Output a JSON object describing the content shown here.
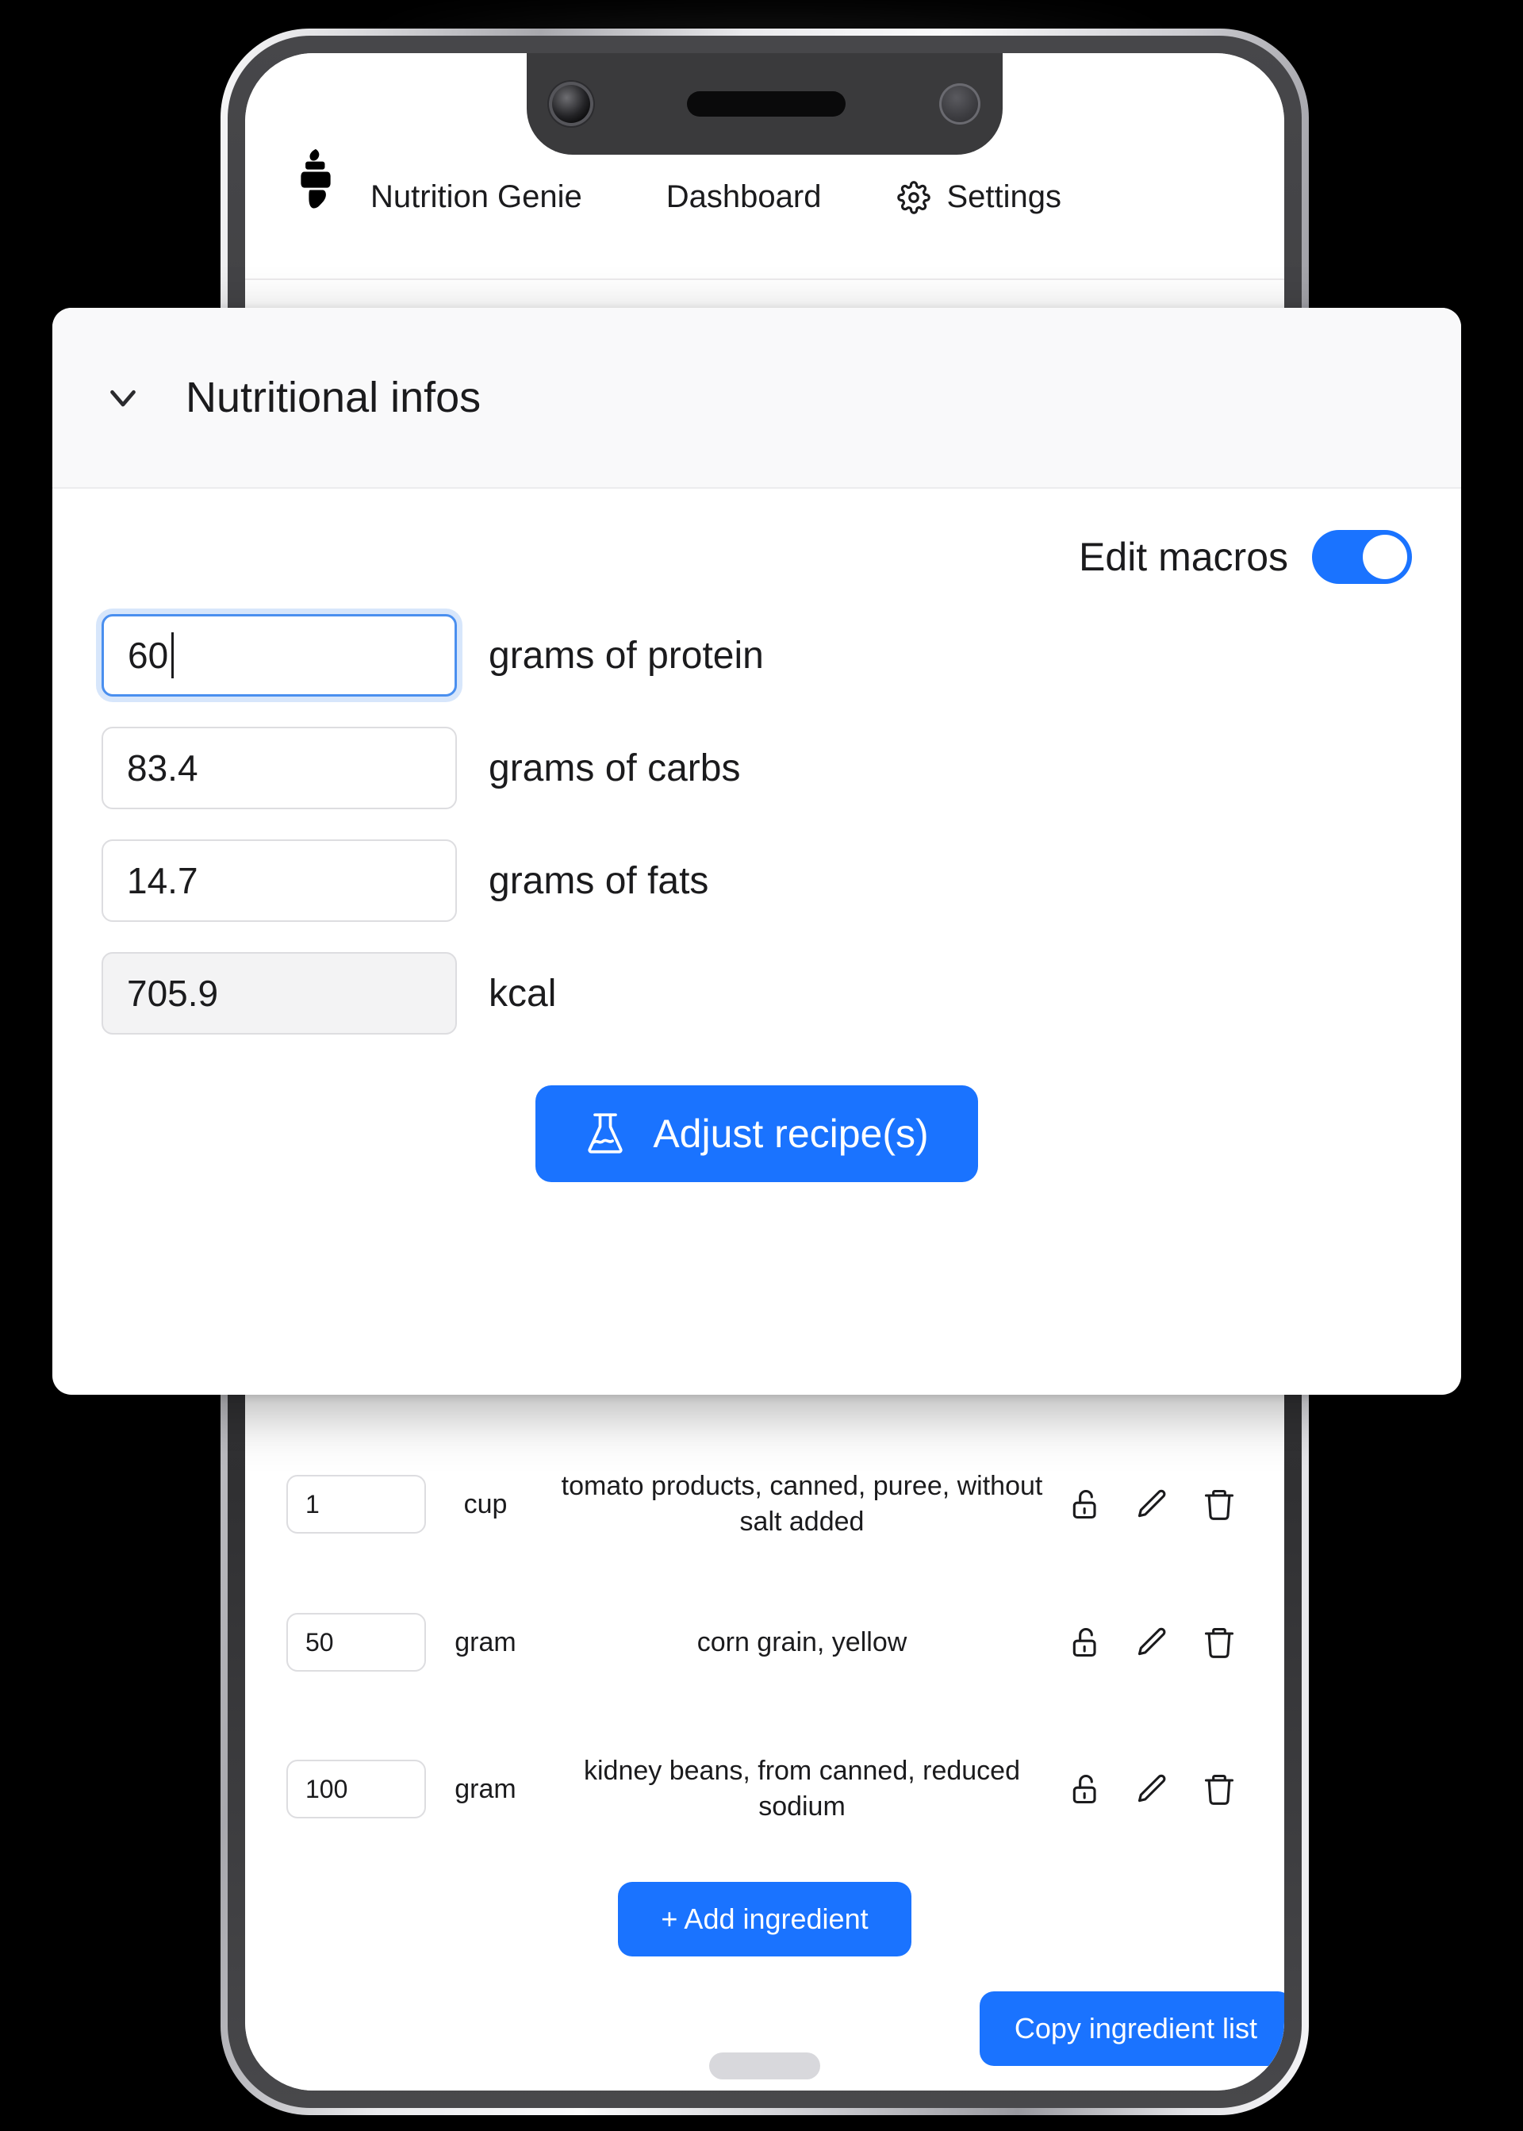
{
  "app": {
    "brand": "Nutrition Genie",
    "logo_icon": "genie-bottle-icon",
    "nav": [
      {
        "label": "Dashboard",
        "icon": null
      },
      {
        "label": "Settings",
        "icon": "gear-icon"
      }
    ]
  },
  "modal": {
    "collapse_icon": "chevron-down-icon",
    "title": "Nutritional infos",
    "edit_macros": {
      "label": "Edit macros",
      "state": "on",
      "accent_color": "#1a73ff"
    },
    "macros": [
      {
        "key": "protein",
        "value": "60",
        "label": "grams of protein",
        "focused": true,
        "readonly": false
      },
      {
        "key": "carbs",
        "value": "83.4",
        "label": "grams of carbs",
        "focused": false,
        "readonly": false
      },
      {
        "key": "fats",
        "value": "14.7",
        "label": "grams of fats",
        "focused": false,
        "readonly": false
      },
      {
        "key": "kcal",
        "value": "705.9",
        "label": "kcal",
        "focused": false,
        "readonly": true
      }
    ],
    "adjust_button": {
      "label": "Adjust recipe(s)",
      "icon": "flask-icon",
      "color": "#1a73ff"
    }
  },
  "ingredients": {
    "rows": [
      {
        "qty": "1",
        "unit": "cup",
        "name": "tomato products, canned, puree, without salt added",
        "actions": [
          "unlock-icon",
          "edit-pencil-icon",
          "trash-icon"
        ]
      },
      {
        "qty": "50",
        "unit": "gram",
        "name": "corn grain, yellow",
        "actions": [
          "unlock-icon",
          "edit-pencil-icon",
          "trash-icon"
        ]
      },
      {
        "qty": "100",
        "unit": "gram",
        "name": "kidney beans, from canned, reduced sodium",
        "actions": [
          "unlock-icon",
          "edit-pencil-icon",
          "trash-icon"
        ]
      }
    ],
    "add_button": "+ Add ingredient",
    "copy_button": "Copy ingredient list"
  }
}
